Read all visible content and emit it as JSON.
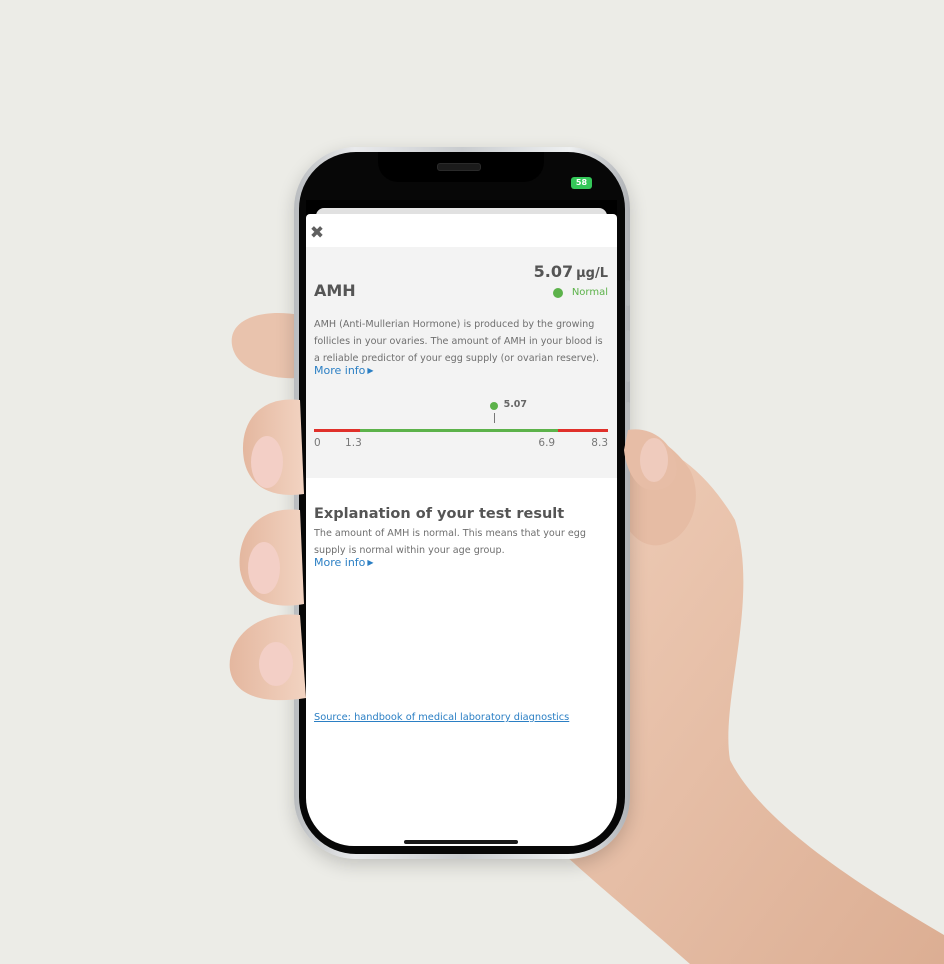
{
  "status_bar": {
    "battery_level": "58"
  },
  "modal": {
    "close_icon": "close-icon"
  },
  "result": {
    "test_name": "AMH",
    "value": "5.07",
    "unit": "µg/L",
    "status": "Normal",
    "status_color": "#5cb24a",
    "description": "AMH (Anti-Mullerian Hormone) is produced by the growing follicles in your ovaries. The amount of AMH in your blood is a reliable predictor of your egg supply (or ovarian reserve).",
    "more_info": "More info"
  },
  "range": {
    "min": 0,
    "low": 1.3,
    "high": 6.9,
    "max": 8.3,
    "marker": 5.07,
    "min_label": "0",
    "low_label": "1.3",
    "high_label": "6.9",
    "max_label": "8.3",
    "marker_label": "5.07",
    "normal_color": "#5cb24a",
    "abnormal_color": "#e0302a"
  },
  "explanation": {
    "title": "Explanation of your test result",
    "text": "The amount of AMH is normal. This means that your egg supply is normal within your age group.",
    "more_info": "More info"
  },
  "source": {
    "label": "Source: handbook of medical laboratory diagnostics"
  }
}
